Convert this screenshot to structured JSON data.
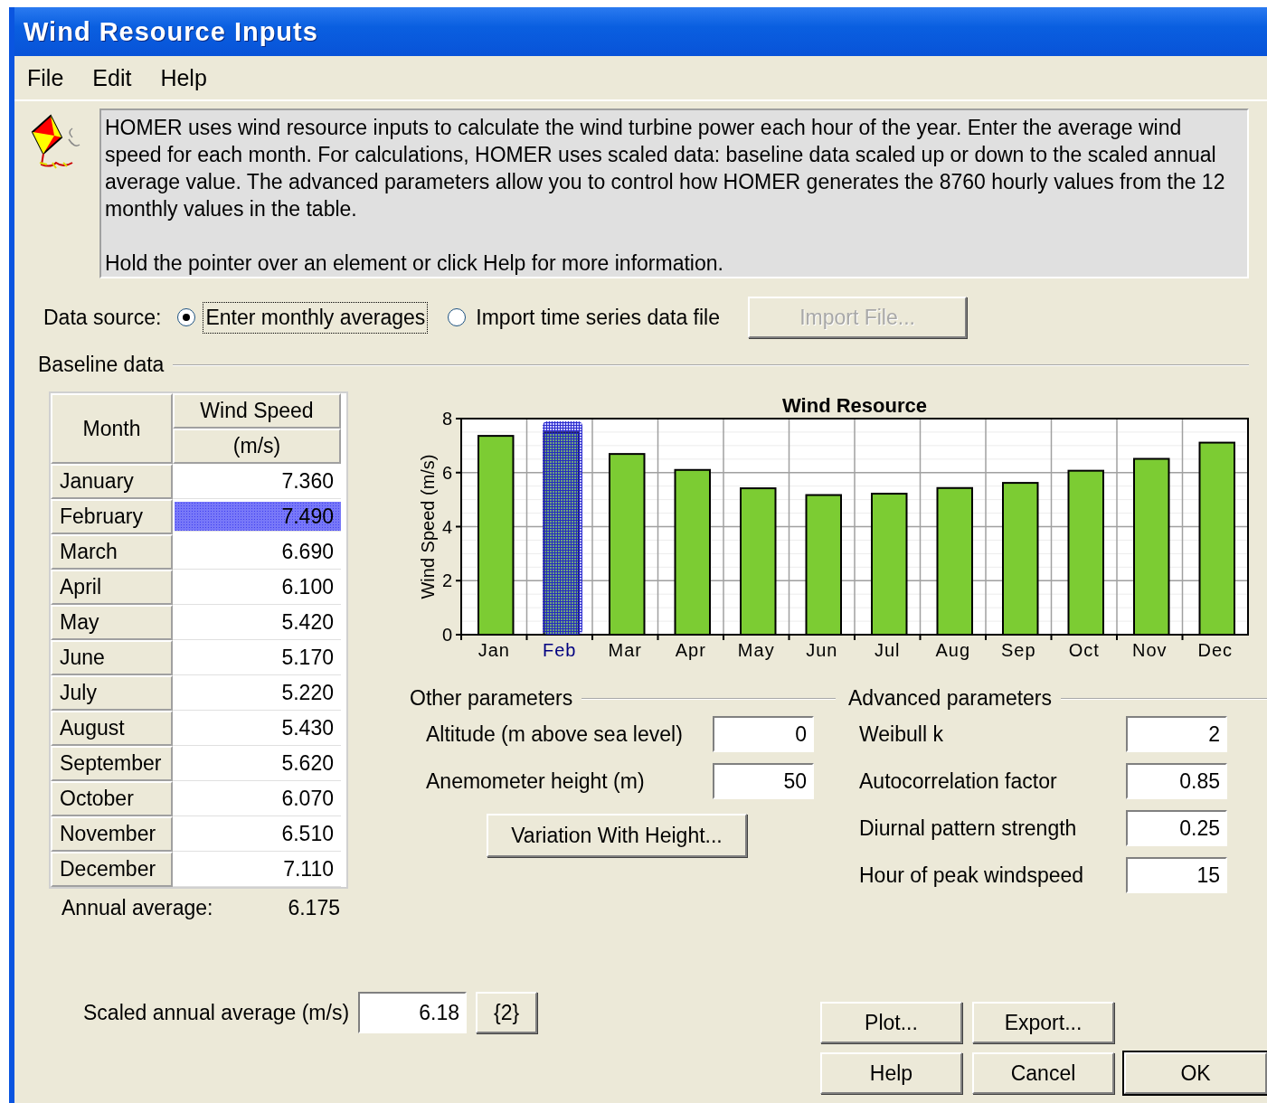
{
  "window": {
    "title": "Wind Resource Inputs"
  },
  "menu": [
    "File",
    "Edit",
    "Help"
  ],
  "description": {
    "paragraphs": [
      "HOMER uses wind resource inputs to calculate the wind turbine power each hour of the year. Enter the average wind speed for each month. For calculations, HOMER uses scaled data: baseline data scaled up or down to the scaled annual average value. The advanced parameters allow you to control how HOMER generates the 8760 hourly values from the 12 monthly values in the table.",
      "Hold the pointer over an element or click Help for more information."
    ]
  },
  "data_source": {
    "label": "Data source:",
    "options": [
      {
        "label": "Enter monthly averages",
        "selected": true
      },
      {
        "label": "Import time series data file",
        "selected": false
      }
    ],
    "import_button": {
      "label": "Import File...",
      "disabled": true
    }
  },
  "baseline": {
    "title": "Baseline data",
    "columns": [
      "Month",
      "Wind Speed",
      "(m/s)"
    ],
    "rows": [
      {
        "month": "January",
        "speed": "7.360",
        "selected": false
      },
      {
        "month": "February",
        "speed": "7.490",
        "selected": true
      },
      {
        "month": "March",
        "speed": "6.690",
        "selected": false
      },
      {
        "month": "April",
        "speed": "6.100",
        "selected": false
      },
      {
        "month": "May",
        "speed": "5.420",
        "selected": false
      },
      {
        "month": "June",
        "speed": "5.170",
        "selected": false
      },
      {
        "month": "July",
        "speed": "5.220",
        "selected": false
      },
      {
        "month": "August",
        "speed": "5.430",
        "selected": false
      },
      {
        "month": "September",
        "speed": "5.620",
        "selected": false
      },
      {
        "month": "October",
        "speed": "6.070",
        "selected": false
      },
      {
        "month": "November",
        "speed": "6.510",
        "selected": false
      },
      {
        "month": "December",
        "speed": "7.110",
        "selected": false
      }
    ],
    "annual_label": "Annual average:",
    "annual_value": "6.175",
    "chart_data": {
      "type": "bar",
      "title": "Wind Resource",
      "ylabel": "Wind Speed (m/s)",
      "categories": [
        "Jan",
        "Feb",
        "Mar",
        "Apr",
        "May",
        "Jun",
        "Jul",
        "Aug",
        "Sep",
        "Oct",
        "Nov",
        "Dec"
      ],
      "values": [
        7.36,
        7.49,
        6.69,
        6.1,
        5.42,
        5.17,
        5.22,
        5.43,
        5.62,
        6.07,
        6.51,
        7.11
      ],
      "ylim": [
        0,
        8
      ],
      "yticks": [
        0,
        2,
        4,
        6,
        8
      ],
      "grid": true
    }
  },
  "other": {
    "title": "Other parameters",
    "fields": [
      {
        "label": "Altitude (m above sea level)",
        "value": "0"
      },
      {
        "label": "Anemometer height (m)",
        "value": "50"
      }
    ],
    "button": "Variation With Height..."
  },
  "advanced": {
    "title": "Advanced parameters",
    "fields": [
      {
        "label": "Weibull k",
        "value": "2"
      },
      {
        "label": "Autocorrelation factor",
        "value": "0.85"
      },
      {
        "label": "Diurnal pattern strength",
        "value": "0.25"
      },
      {
        "label": "Hour of peak windspeed",
        "value": "15"
      }
    ]
  },
  "scaled": {
    "label": "Scaled annual average (m/s)",
    "value": "6.18",
    "button": "{2}"
  },
  "buttons": [
    {
      "label": "Plot...",
      "default": false
    },
    {
      "label": "Export...",
      "default": false
    },
    {
      "label": "Help",
      "default": false
    },
    {
      "label": "Cancel",
      "default": false
    },
    {
      "label": "OK",
      "default": true
    }
  ]
}
